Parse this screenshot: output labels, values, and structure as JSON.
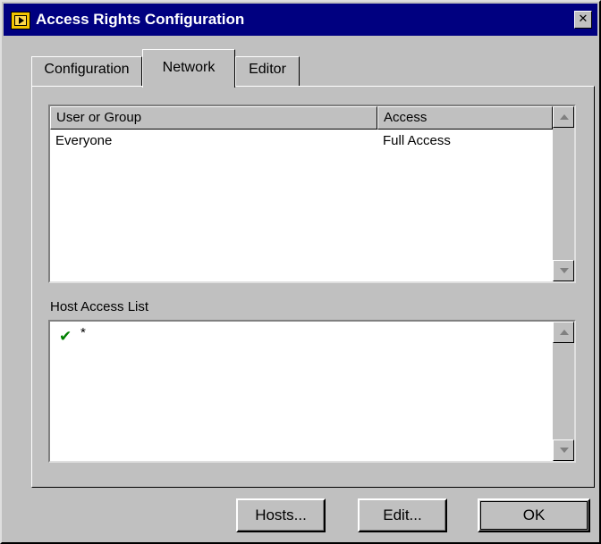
{
  "window": {
    "title": "Access Rights Configuration",
    "close_glyph": "✕"
  },
  "tabs": [
    {
      "label": "Configuration",
      "active": false
    },
    {
      "label": "Network",
      "active": true
    },
    {
      "label": "Editor",
      "active": false
    }
  ],
  "access_table": {
    "headers": [
      "User or Group",
      "Access"
    ],
    "rows": [
      {
        "user": "Everyone",
        "access": "Full Access"
      }
    ]
  },
  "host_access": {
    "label": "Host Access List",
    "items": [
      {
        "icon": "checkmark-icon",
        "glyph": "✔",
        "host": "*"
      }
    ]
  },
  "buttons": {
    "hosts": "Hosts...",
    "edit": "Edit...",
    "ok": "OK"
  },
  "colors": {
    "titlebar": "#000080",
    "face": "#c0c0c0",
    "check": "#008000"
  }
}
